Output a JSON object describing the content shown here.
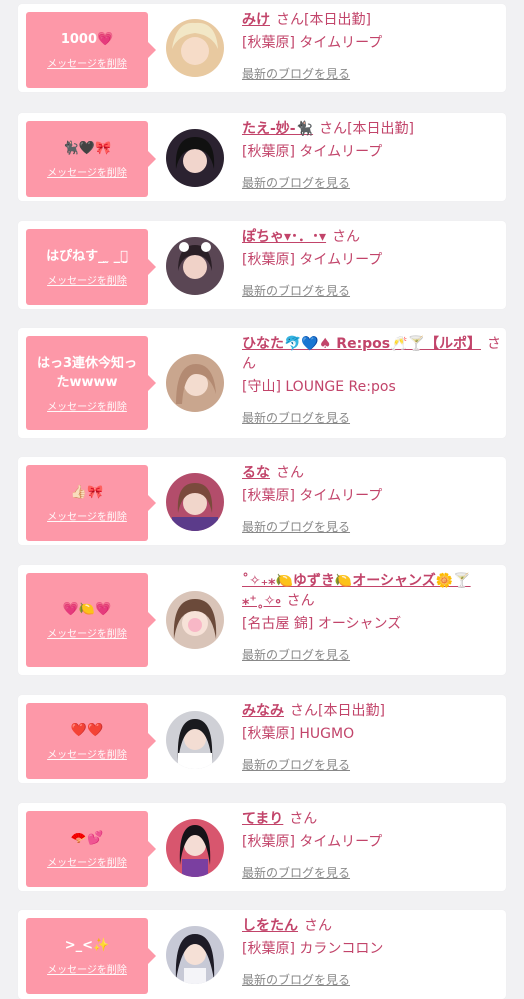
{
  "entries": [
    {
      "message": "1000💗",
      "delete_label": "メッセージを削除",
      "name": "みけ",
      "san": "さん",
      "status": "[本日出勤]",
      "shop": "[秋葉原] タイムリープ",
      "blog_label": "最新のブログを見る",
      "avatar_color": "#e8c9a0"
    },
    {
      "message": "🐈‍⬛🖤🎀",
      "delete_label": "メッセージを削除",
      "name": "たえ-妙-🐈‍⬛",
      "san": "さん",
      "status": "[本日出勤]",
      "shop": "[秋葉原] タイムリープ",
      "blog_label": "最新のブログを見る",
      "avatar_color": "#2b2230"
    },
    {
      "message": "はぴねす_ ̫ _ꪔ̤̮",
      "delete_label": "メッセージを削除",
      "name": "ぽちゃ▾･．･▾",
      "san": "さん",
      "status": "",
      "shop": "[秋葉原] タイムリープ",
      "blog_label": "最新のブログを見る",
      "avatar_color": "#5a4654"
    },
    {
      "message": "はっ3連休今知ったwwww",
      "delete_label": "メッセージを削除",
      "name": "ひなた🐬💙♠ Re:pos🥂🍸【ルポ】",
      "san": "さん",
      "status": "",
      "shop": "[守山] LOUNGE Re:pos",
      "blog_label": "最新のブログを見る",
      "avatar_color": "#c9a68e"
    },
    {
      "message": "👍🏻🎀",
      "delete_label": "メッセージを削除",
      "name": "るな",
      "san": "さん",
      "status": "",
      "shop": "[秋葉原] タイムリープ",
      "blog_label": "最新のブログを見る",
      "avatar_color": "#b34d6b"
    },
    {
      "message": "💗🍋💗",
      "delete_label": "メッセージを削除",
      "name": "˚✧₊⁎🍋ゆずき🍋オーシャンズ🌼🍸⁎⁺˳✧༚",
      "san": "さん",
      "status": "",
      "shop": "[名古屋 錦] オーシャンズ",
      "blog_label": "最新のブログを見る",
      "avatar_color": "#d9c4b8"
    },
    {
      "message": "❤️❤️",
      "delete_label": "メッセージを削除",
      "name": "みなみ",
      "san": "さん",
      "status": "[本日出勤]",
      "shop": "[秋葉原] HUGMO",
      "blog_label": "最新のブログを見る",
      "avatar_color": "#cfd0d6"
    },
    {
      "message": "🪭💕",
      "delete_label": "メッセージを削除",
      "name": "てまり",
      "san": "さん",
      "status": "",
      "shop": "[秋葉原] タイムリープ",
      "blog_label": "最新のブログを見る",
      "avatar_color": "#d8566e"
    },
    {
      "message": ">_<✨",
      "delete_label": "メッセージを削除",
      "name": "しをたん",
      "san": "さん",
      "status": "",
      "shop": "[秋葉原] カランコロン",
      "blog_label": "最新のブログを見る",
      "avatar_color": "#c7c9d6"
    }
  ]
}
